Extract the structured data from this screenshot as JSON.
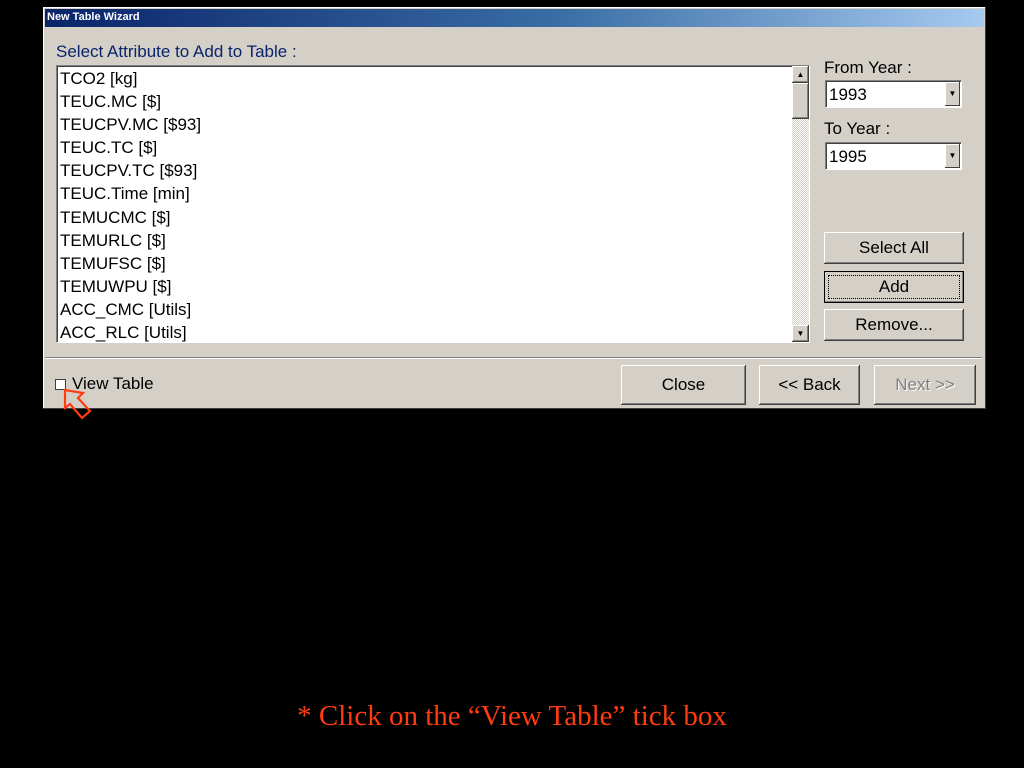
{
  "window": {
    "title": "New Table Wizard"
  },
  "attribute_list": {
    "label": "Select Attribute to Add to Table :",
    "items": [
      "TCO2 [kg]",
      "TEUC.MC [$]",
      "TEUCPV.MC [$93]",
      "TEUC.TC [$]",
      "TEUCPV.TC [$93]",
      "TEUC.Time [min]",
      "TEMUCMC [$]",
      "TEMURLC [$]",
      "TEMUFSC [$]",
      "TEMUWPU [$]",
      "ACC_CMC [Utils]",
      "ACC_RLC [Utils]"
    ]
  },
  "from_year": {
    "label": "From Year :",
    "value": "1993"
  },
  "to_year": {
    "label": "To Year :",
    "value": "1995"
  },
  "side_buttons": {
    "select_all": "Select All",
    "add": "Add",
    "remove": "Remove..."
  },
  "view_table": {
    "label": "View Table",
    "checked": false
  },
  "footer_buttons": {
    "close": "Close",
    "back": "<< Back",
    "next": "Next >>"
  },
  "caption": "* Click on the “View Table” tick box",
  "colors": {
    "title_bar": "#0a246a",
    "caption": "#ff3b10",
    "pointer": "#ff3b10"
  },
  "icons": {
    "pointer": "arrow-pointer-icon"
  }
}
